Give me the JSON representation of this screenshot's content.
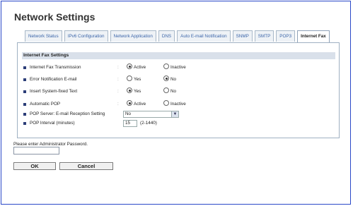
{
  "page_title": "Network Settings",
  "tabs": [
    {
      "label": "Network Status"
    },
    {
      "label": "IPv6 Configuration"
    },
    {
      "label": "Network Application"
    },
    {
      "label": "DNS"
    },
    {
      "label": "Auto E-mail Notification"
    },
    {
      "label": "SNMP"
    },
    {
      "label": "SMTP"
    },
    {
      "label": "POP3"
    },
    {
      "label": "Internet Fax",
      "active": true
    }
  ],
  "section_title": "Internet Fax Settings",
  "settings": {
    "transmission": {
      "label": "Internet Fax Transmission",
      "options": [
        "Active",
        "Inactive"
      ],
      "selected": "Active"
    },
    "error_email": {
      "label": "Error Notification E-mail",
      "options": [
        "Yes",
        "No"
      ],
      "selected": "No"
    },
    "fixed_text": {
      "label": "Insert System-fixed Text",
      "options": [
        "Yes",
        "No"
      ],
      "selected": "Yes"
    },
    "auto_pop": {
      "label": "Automatic POP",
      "options": [
        "Active",
        "Inactive"
      ],
      "selected": "Active"
    },
    "pop_server": {
      "label": "POP Server: E-mail Reception Setting",
      "value": "No"
    },
    "pop_interval": {
      "label": "POP Interval (minutes)",
      "value": "15",
      "hint": "(2-1440)"
    }
  },
  "password": {
    "label": "Please enter Administrator Password.",
    "value": ""
  },
  "buttons": {
    "ok": "OK",
    "cancel": "Cancel"
  }
}
